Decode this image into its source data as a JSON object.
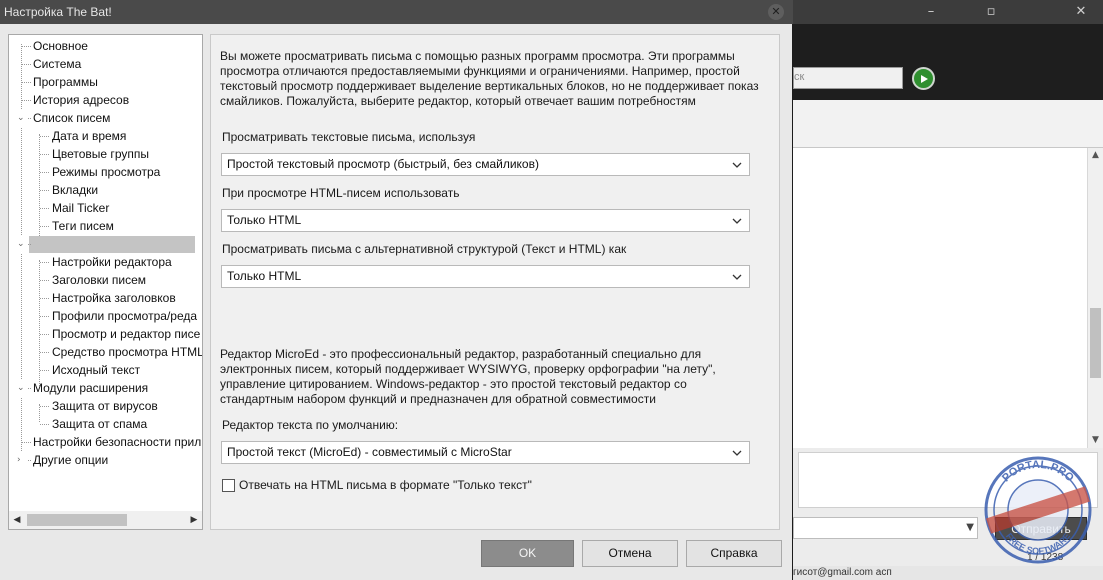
{
  "background_window": {
    "search_placeholder": "ск",
    "send_button": "Отправить",
    "status_left": "гисот@gmail.com асп",
    "status_right": "1 / 1238",
    "stamp_text_top": "PORTAL.PRO",
    "stamp_text_bottom": "FREE SOFTWARE"
  },
  "dialog": {
    "title": "Настройка The Bat!",
    "tree": {
      "items": [
        {
          "label": "Основное"
        },
        {
          "label": "Система"
        },
        {
          "label": "Программы"
        },
        {
          "label": "История адресов"
        },
        {
          "label": "Список писем"
        },
        {
          "label": "Дата и время"
        },
        {
          "label": "Цветовые группы"
        },
        {
          "label": "Режимы просмотра"
        },
        {
          "label": "Вкладки"
        },
        {
          "label": "Mail Ticker"
        },
        {
          "label": "Теги писем"
        },
        {
          "label": ""
        },
        {
          "label": "Настройки редактора"
        },
        {
          "label": "Заголовки писем"
        },
        {
          "label": "Настройка заголовков"
        },
        {
          "label": "Профили просмотра/реда"
        },
        {
          "label": "Просмотр и редактор писе"
        },
        {
          "label": "Средство просмотра HTML"
        },
        {
          "label": "Исходный текст"
        },
        {
          "label": "Модули расширения"
        },
        {
          "label": "Защита от вирусов"
        },
        {
          "label": "Защита от спама"
        },
        {
          "label": "Настройки безопасности прил"
        },
        {
          "label": "Другие опции"
        }
      ]
    },
    "content": {
      "intro": "Вы можете просматривать письма с помощью разных программ просмотра. Эти программы просмотра отличаются предоставляемыми функциями и ограничениями. Например, простой текстовый просмотр поддерживает выделение вертикальных блоков, но не поддерживает показ смайликов. Пожалуйста, выберите редактор, который отвечает вашим потребностям",
      "text_view_label": "Просматривать текстовые письма, используя",
      "text_view_value": "Простой текстовый просмотр (быстрый, без смайликов)",
      "html_view_label": "При просмотре HTML-писем использовать",
      "html_view_value": "Только HTML",
      "alt_view_label": "Просматривать письма с альтернативной структурой (Текст и HTML) как",
      "alt_view_value": "Только HTML",
      "editor_desc": "Редактор MicroEd - это профессиональный редактор, разработанный специально для электронных писем, который поддерживает WYSIWYG, проверку орфографии \"на лету\", управление цитированием. Windows-редактор - это простой текстовый редактор со стандартным набором функций и предназначен для обратной совместимости",
      "default_editor_label": "Редактор текста по умолчанию:",
      "default_editor_value": "Простой текст (MicroEd)  - совместимый с MicroStar",
      "reply_plain_checkbox": "Отвечать на HTML письма в формате \"Только текст\"",
      "reply_plain_checked": false
    },
    "buttons": {
      "ok": "OK",
      "cancel": "Отмена",
      "help": "Справка"
    }
  }
}
